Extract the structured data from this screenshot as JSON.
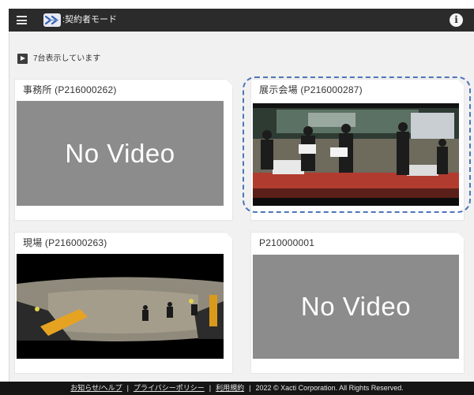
{
  "header": {
    "mode_label": ":契約者モード",
    "info_label": "i"
  },
  "status": {
    "count_text": "7台表示しています"
  },
  "cameras": [
    {
      "title": "事務所 (P216000262)",
      "video": "No Video"
    },
    {
      "title": "展示会場 (P216000287)",
      "video": "live"
    },
    {
      "title": "現場 (P216000263)",
      "video": "live"
    },
    {
      "title": "P210000001",
      "video": "No Video"
    }
  ],
  "footer": {
    "news_help": "お知らせ/ヘルプ",
    "privacy": "プライバシーポリシー",
    "terms": "利用規約",
    "copyright": "2022 © Xacti Corporation. All Rights Reserved.",
    "separator": "|"
  },
  "colors": {
    "topbar": "#2b2b2b",
    "no_video_bg": "#8c8c8c",
    "highlight": "#4f74b8",
    "footer": "#151515"
  }
}
